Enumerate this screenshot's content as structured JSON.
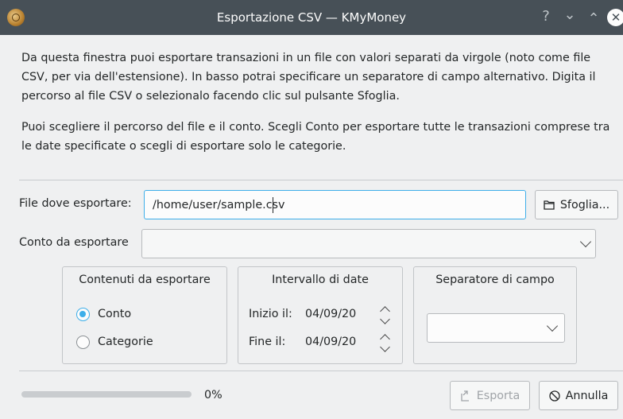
{
  "window": {
    "title": "Esportazione CSV — KMyMoney",
    "help_glyph": "?",
    "minimize_glyph": "⌄",
    "maximize_glyph": "⌃",
    "close_glyph": "✕"
  },
  "intro": {
    "paragraph1": "Da questa finestra puoi esportare transazioni in un file con valori separati da virgole (noto come file CSV, per via dell'estensione). In basso potrai specificare un separatore di campo alternativo. Digita il percorso al file CSV o selezionalo facendo clic sul pulsante Sfoglia.",
    "paragraph2": "Puoi scegliere il percorso del file e il conto. Scegli Conto per esportare tutte le transazioni comprese tra le date specificate o scegli di esportare solo le categorie."
  },
  "file": {
    "label": "File dove esportare:",
    "value": "/home/user/sample.csv",
    "browse_label": "Sfoglia..."
  },
  "account": {
    "label": "Conto da esportare",
    "value": ""
  },
  "contents": {
    "title": "Contenuti da esportare",
    "options": [
      {
        "label": "Conto",
        "checked": true
      },
      {
        "label": "Categorie",
        "checked": false
      }
    ]
  },
  "date_range": {
    "title": "Intervallo di date",
    "start_label": "Inizio il:",
    "start_value": "04/09/20",
    "end_label": "Fine il:",
    "end_value": "04/09/20"
  },
  "separator": {
    "title": "Separatore di campo",
    "value": ""
  },
  "progress": {
    "value": 0,
    "text": "0%"
  },
  "actions": {
    "export_label": "Esporta",
    "export_enabled": false,
    "cancel_label": "Annulla"
  },
  "colors": {
    "titlebar": "#475057",
    "accent": "#3daee9",
    "window_bg": "#eff0f1"
  }
}
